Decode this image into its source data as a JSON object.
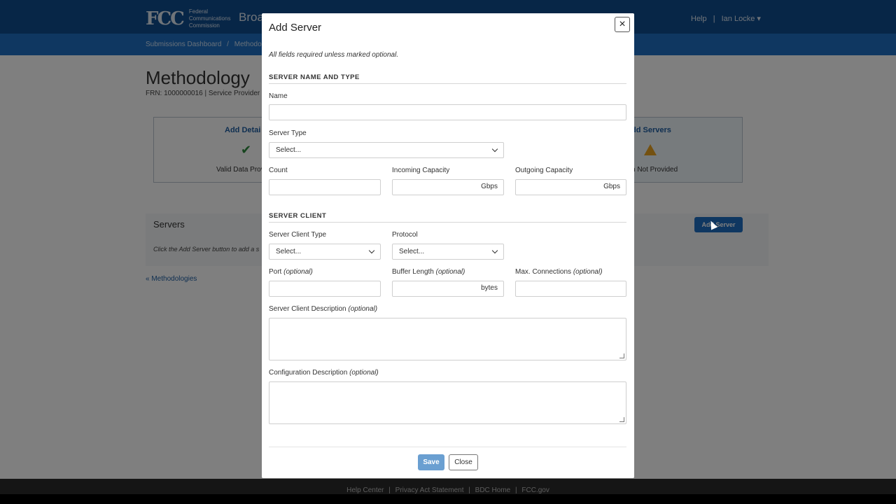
{
  "header": {
    "logo_mark": "FCC",
    "logo_lines": [
      "Federal",
      "Communications",
      "Commission"
    ],
    "app_title": "Broa",
    "help": "Help",
    "separator": "|",
    "user": "Ian Locke",
    "user_caret": "▾"
  },
  "breadcrumb": {
    "item1": "Submissions Dashboard",
    "sep": "/",
    "item2": "Methodolo"
  },
  "page": {
    "title": "Methodology",
    "frn_line": "FRN: 1000000016 | Service Provider |",
    "card_left_title": "Add Detai",
    "card_left_status": "Valid Data Prov",
    "card_right_title": "dd Servers",
    "card_right_status": "n Not Provided",
    "servers_heading": "Servers",
    "servers_hint": "Click the Add Server button to add a s",
    "add_server_button": "Add Server",
    "back_link": "« Methodologies"
  },
  "footer": {
    "links": [
      "Help Center",
      "Privacy Act Statement",
      "BDC Home",
      "FCC.gov"
    ],
    "sep": "|"
  },
  "modal": {
    "title": "Add Server",
    "close_icon": "×",
    "note": "All fields required unless marked optional.",
    "section1": "SERVER NAME AND TYPE",
    "name_label": "Name",
    "server_type_label": "Server Type",
    "server_type_value": "Select...",
    "count_label": "Count",
    "incoming_label": "Incoming Capacity",
    "incoming_unit": "Gbps",
    "outgoing_label": "Outgoing Capacity",
    "outgoing_unit": "Gbps",
    "section2": "SERVER CLIENT",
    "client_type_label": "Server Client Type",
    "client_type_value": "Select...",
    "protocol_label": "Protocol",
    "protocol_value": "Select...",
    "port_label": "Port",
    "buffer_label": "Buffer Length",
    "buffer_unit": "bytes",
    "maxconn_label": "Max. Connections",
    "optional": "(optional)",
    "client_desc_label": "Server Client Description",
    "config_desc_label": "Configuration Description",
    "save_button": "Save",
    "close_button": "Close"
  }
}
